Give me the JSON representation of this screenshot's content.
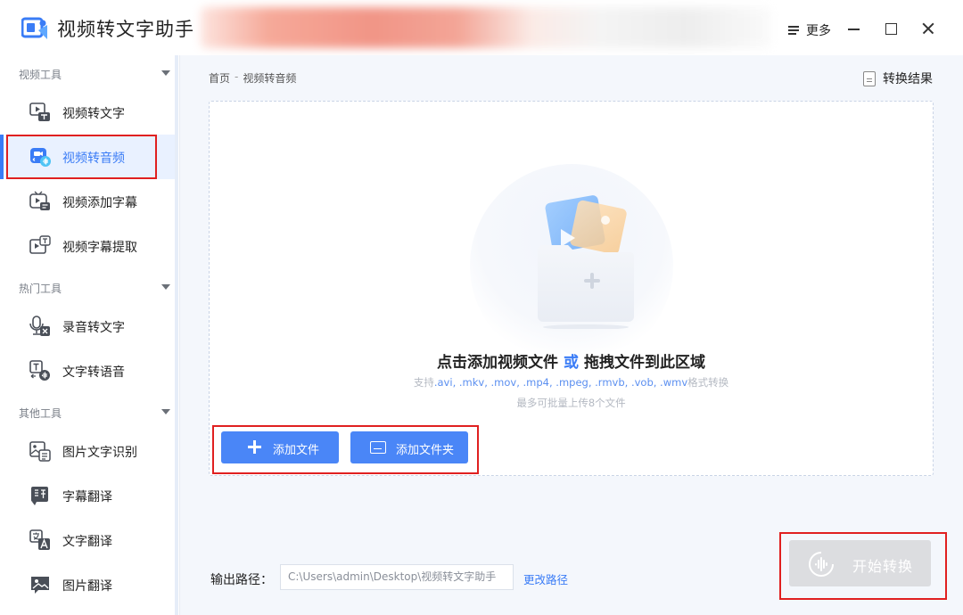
{
  "app": {
    "title": "视频转文字助手",
    "more_label": "更多"
  },
  "sidebar": {
    "sections": [
      {
        "title": "视频工具",
        "items": [
          {
            "label": "视频转文字",
            "icon": "video-to-text-icon"
          },
          {
            "label": "视频转音频",
            "icon": "video-to-audio-icon",
            "active": true
          },
          {
            "label": "视频添加字幕",
            "icon": "add-subtitle-icon"
          },
          {
            "label": "视频字幕提取",
            "icon": "extract-subtitle-icon"
          }
        ]
      },
      {
        "title": "热门工具",
        "items": [
          {
            "label": "录音转文字",
            "icon": "microphone-icon"
          },
          {
            "label": "文字转语音",
            "icon": "text-to-speech-icon"
          }
        ]
      },
      {
        "title": "其他工具",
        "items": [
          {
            "label": "图片文字识别",
            "icon": "image-ocr-icon"
          },
          {
            "label": "字幕翻译",
            "icon": "subtitle-translate-icon"
          },
          {
            "label": "文字翻译",
            "icon": "text-translate-icon"
          },
          {
            "label": "图片翻译",
            "icon": "image-translate-icon"
          }
        ]
      }
    ]
  },
  "main": {
    "breadcrumb": {
      "home": "首页",
      "separator": "-",
      "current": "视频转音频"
    },
    "result_link": "转换结果",
    "dropzone": {
      "title_part1": "点击添加视频文件",
      "title_or": "或",
      "title_part2": "拖拽文件到此区域",
      "formats_prefix": "支持",
      "formats": ".avi, .mkv, .mov, .mp4, .mpeg, .rmvb, .vob, .wmv",
      "formats_suffix": "格式转换",
      "limit": "最多可批量上传8个文件"
    },
    "add_file_label": "添加文件",
    "add_folder_label": "添加文件夹",
    "output": {
      "label": "输出路径：",
      "path": "C:\\Users\\admin\\Desktop\\视频转文字助手",
      "change_label": "更改路径"
    },
    "start_label": "开始转换"
  },
  "colors": {
    "accent": "#3a7cf6",
    "button": "#4a86f7",
    "highlight_box": "#e02020",
    "disabled_button": "#dcdde0"
  }
}
